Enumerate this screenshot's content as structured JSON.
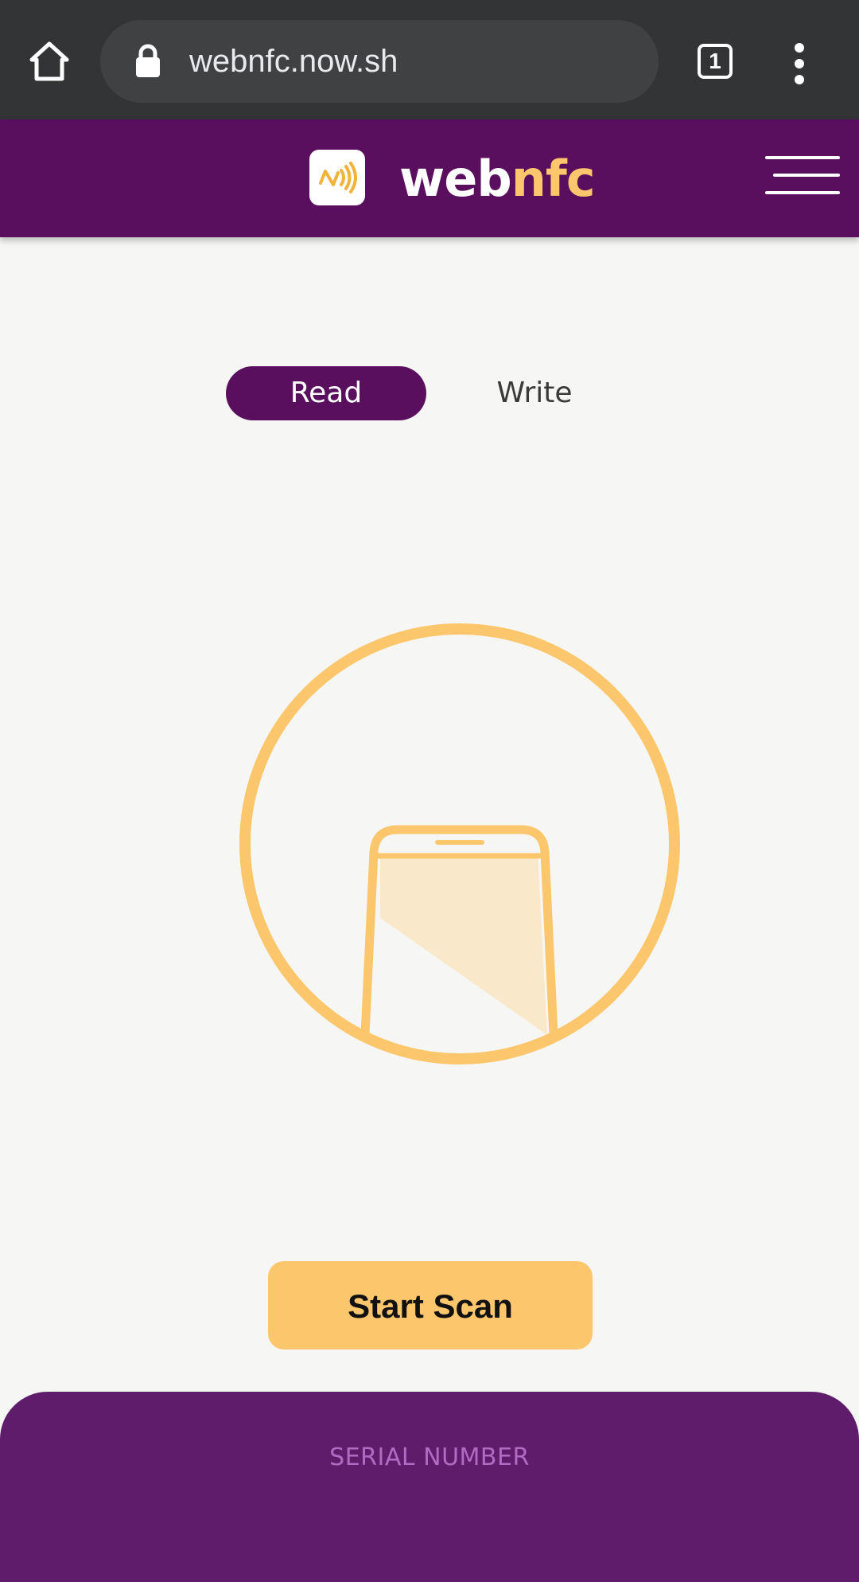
{
  "browser": {
    "url": "webnfc.now.sh",
    "tab_count": "1",
    "home_icon": "home-icon",
    "lock_icon": "lock-icon",
    "menu_icon": "more-vert-icon"
  },
  "header": {
    "logo_icon": "nfc-icon",
    "brand_web": "web",
    "brand_nfc": "nfc",
    "menu_icon": "hamburger-menu-icon"
  },
  "mode_toggle": {
    "read_label": "Read",
    "write_label": "Write",
    "selected": "Read"
  },
  "illustration": {
    "icon": "phone-scan-icon"
  },
  "actions": {
    "start_scan_label": "Start Scan"
  },
  "result_panel": {
    "serial_label": "SERIAL NUMBER"
  },
  "colors": {
    "brand_purple": "#5a0f5e",
    "panel_purple": "#5f1c6b",
    "accent_yellow": "#fcc76c",
    "background": "#f6f6f4",
    "browser_bar": "#323436"
  }
}
